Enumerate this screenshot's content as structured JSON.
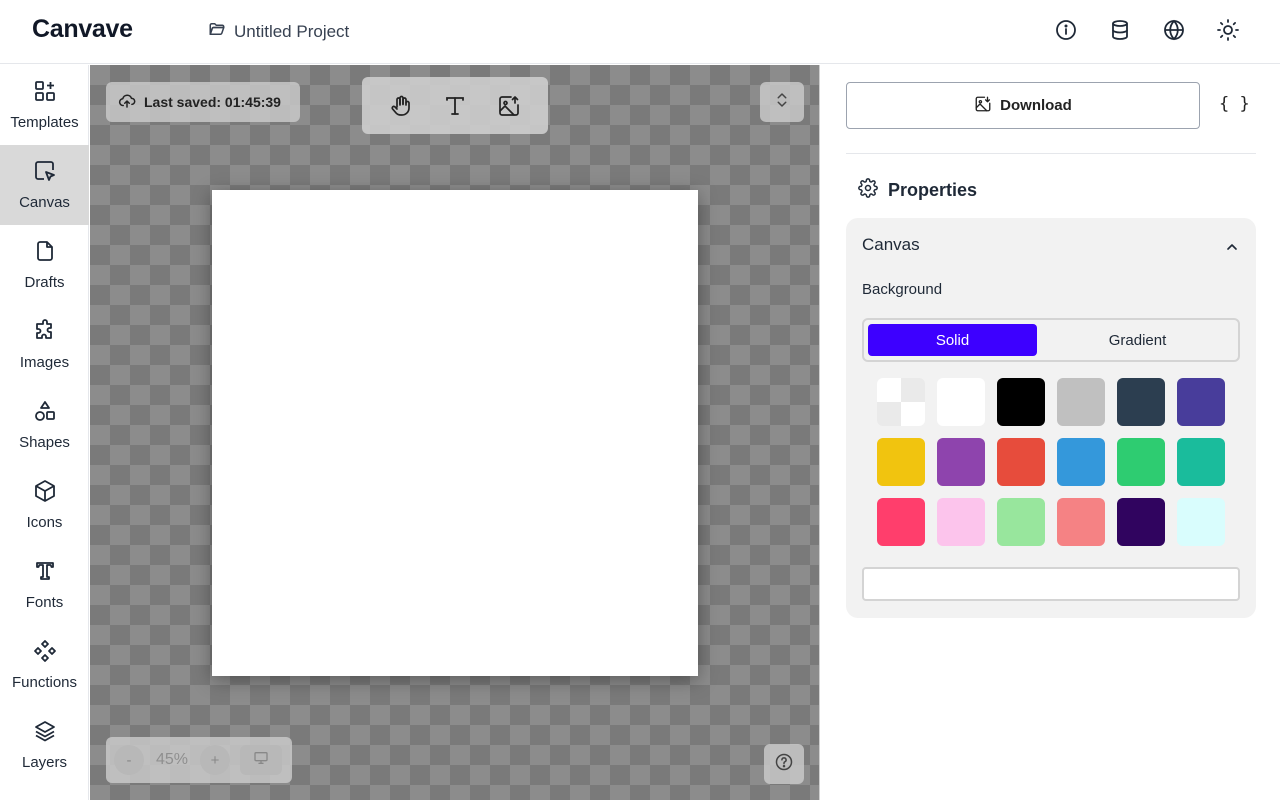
{
  "header": {
    "logo": "Canvave",
    "project_name": "Untitled Project",
    "icons": [
      "info-icon",
      "database-icon",
      "globe-icon",
      "sun-icon"
    ]
  },
  "sidebar": {
    "items": [
      {
        "label": "Templates",
        "icon": "templates-icon"
      },
      {
        "label": "Canvas",
        "icon": "canvas-cursor-icon",
        "active": true
      },
      {
        "label": "Drafts",
        "icon": "file-icon"
      },
      {
        "label": "Images",
        "icon": "puzzle-icon"
      },
      {
        "label": "Shapes",
        "icon": "shapes-icon"
      },
      {
        "label": "Icons",
        "icon": "cube-icon"
      },
      {
        "label": "Fonts",
        "icon": "font-icon"
      },
      {
        "label": "Functions",
        "icon": "functions-icon"
      },
      {
        "label": "Layers",
        "icon": "layers-icon"
      }
    ]
  },
  "canvas": {
    "last_saved": "Last saved: 01:45:39",
    "tools": [
      "hand-icon",
      "text-icon",
      "image-upload-icon"
    ],
    "zoom": "45%",
    "zoom_minus": "-",
    "zoom_plus": "+"
  },
  "panel": {
    "download_label": "Download",
    "json_label": "{ }",
    "properties_title": "Properties",
    "section_title": "Canvas",
    "background_label": "Background",
    "mode_solid": "Solid",
    "mode_gradient": "Gradient",
    "selected_mode": "Solid",
    "accent_color": "#3d00ff",
    "swatches": [
      "transparent",
      "#ffffff",
      "#000000",
      "#c0c0c0",
      "#2c3e50",
      "#483d9b",
      "#f1c40f",
      "#8e44ad",
      "#e74c3c",
      "#3498db",
      "#2ecc71",
      "#1abc9c",
      "#ff3e6c",
      "#fcc4ec",
      "#98e69d",
      "#f58284",
      "#30045f",
      "#d9fdfd"
    ],
    "color_value": ""
  }
}
